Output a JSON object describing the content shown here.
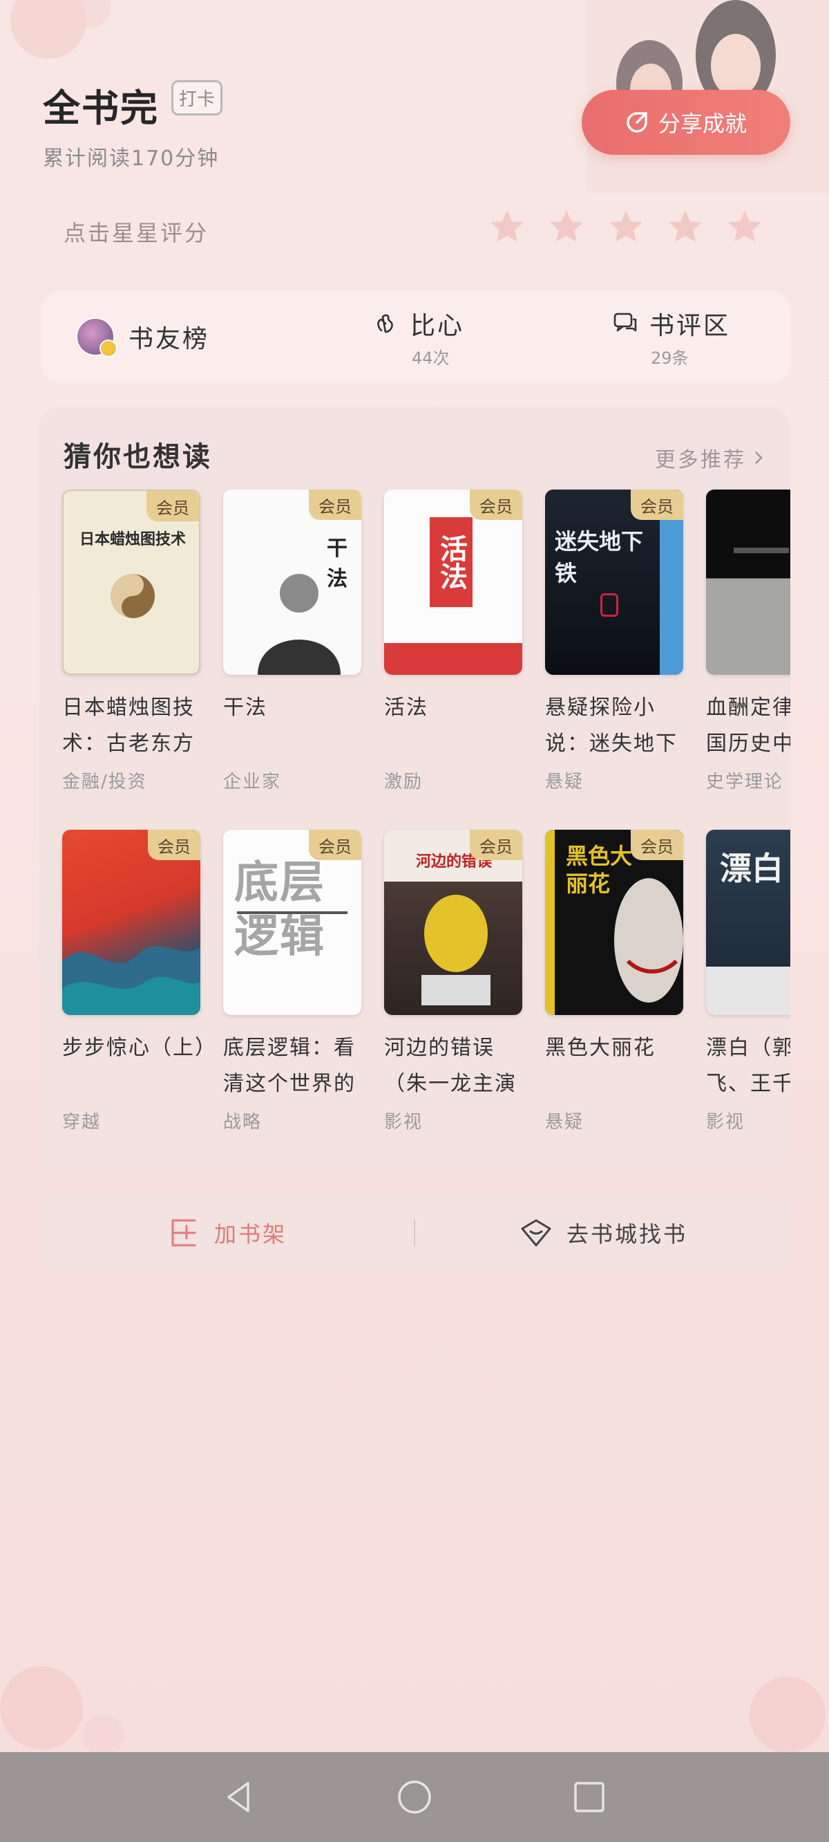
{
  "header": {
    "title": "全书完",
    "checkin_badge": "打卡",
    "read_time": "累计阅读170分钟",
    "share_label": "分享成就"
  },
  "rating": {
    "hint": "点击星星评分",
    "stars_total": 5,
    "stars_selected": 0
  },
  "stats": {
    "fans_label": "书友榜",
    "heart_label": "比心",
    "heart_count": "44次",
    "review_label": "书评区",
    "review_count": "29条"
  },
  "recommend": {
    "title": "猜你也想读",
    "more_label": "更多推荐",
    "vip_badge": "会员",
    "books": [
      {
        "name": "日本蜡烛图技术：古老东方",
        "tag": "金融/投资",
        "vip": true,
        "cover_title": "日本蜡烛图技术"
      },
      {
        "name": "干法",
        "tag": "企业家",
        "vip": true,
        "cover_title": "干法"
      },
      {
        "name": "活法",
        "tag": "激励",
        "vip": true,
        "cover_title": "活法"
      },
      {
        "name": "悬疑探险小说：迷失地下",
        "tag": "悬疑",
        "vip": true,
        "cover_title": "迷失地下铁"
      },
      {
        "name": "血酬定律：中国历史中",
        "tag": "史学理论",
        "vip": false,
        "cover_title": ""
      },
      {
        "name": "步步惊心（上）",
        "tag": "穿越",
        "vip": true,
        "cover_title": ""
      },
      {
        "name": "底层逻辑：看清这个世界的",
        "tag": "战略",
        "vip": true,
        "cover_title": "底层逻辑"
      },
      {
        "name": "河边的错误（朱一龙主演",
        "tag": "影视",
        "vip": true,
        "cover_title": "河边的错误"
      },
      {
        "name": "黑色大丽花",
        "tag": "悬疑",
        "vip": true,
        "cover_title": "黑色大丽花"
      },
      {
        "name": "漂白（郭京飞、王千",
        "tag": "影视",
        "vip": false,
        "cover_title": "漂白"
      }
    ]
  },
  "actions": {
    "add_shelf": "加书架",
    "go_store": "去书城找书"
  },
  "colors": {
    "accent": "#ec7673",
    "vip_badge": "#e8cd92",
    "background": "#f7e6e3"
  }
}
